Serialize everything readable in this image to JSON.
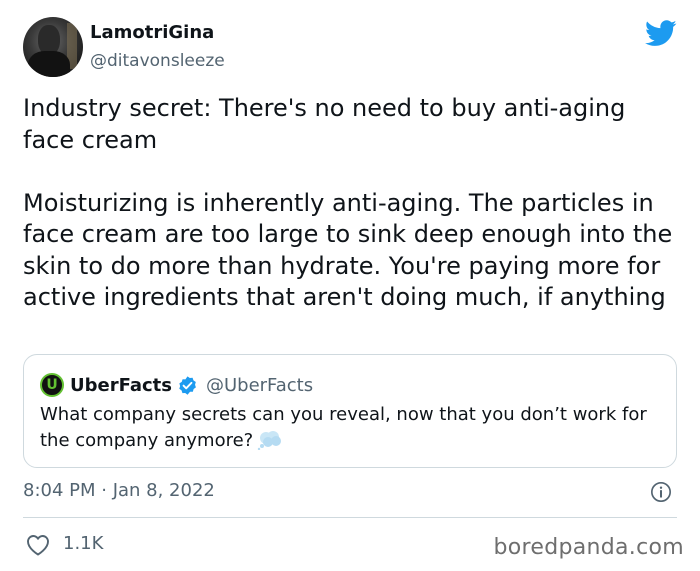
{
  "author": {
    "display_name": "LamotriGina",
    "handle": "@ditavonsleeze"
  },
  "brand_icon": "twitter-bird-icon",
  "tweet": {
    "paragraph1": "Industry secret: There's no need to buy anti-aging face cream",
    "paragraph2": "Moisturizing is inherently anti-aging. The particles in face cream are too large to sink deep enough into the skin to do more than hydrate. You're paying more for active ingredients that aren't doing much, if anything"
  },
  "quoted_tweet": {
    "logo_letter": "U",
    "name": "UberFacts",
    "verified_icon": "verified-badge-icon",
    "handle": "@UberFacts",
    "text": "What company secrets can you reveal, now that you don’t work for the company anymore?",
    "emoji_icon": "thought-balloon-icon"
  },
  "meta": {
    "timestamp": "8:04 PM · Jan 8, 2022"
  },
  "actions": {
    "like_count": "1.1K"
  },
  "watermark": "boredpanda.com",
  "colors": {
    "twitter_blue": "#1d9bf0",
    "text_primary": "#0f1419",
    "text_secondary": "#536471",
    "border": "#cfd9de"
  }
}
